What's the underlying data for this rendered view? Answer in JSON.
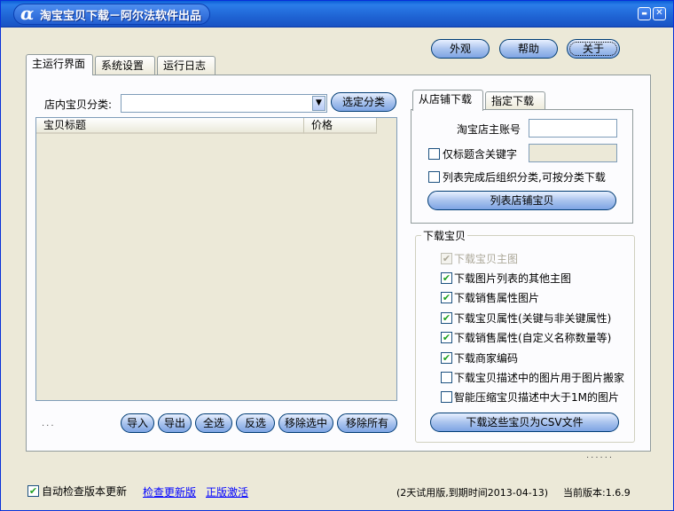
{
  "window": {
    "title": "淘宝宝贝下载－阿尔法软件出品",
    "logo_glyph": "α",
    "minimize_glyph": "▬",
    "close_glyph": "✕"
  },
  "top_buttons": {
    "appearance": "外观",
    "help": "帮助",
    "about": "关于"
  },
  "main_tabs": [
    {
      "label": "主运行界面",
      "active": true
    },
    {
      "label": "系统设置",
      "active": false
    },
    {
      "label": "运行日志",
      "active": false
    }
  ],
  "category": {
    "label": "店内宝贝分类:",
    "value": "",
    "arrow_glyph": "▼",
    "select_button": "选定分类"
  },
  "product_table": {
    "columns": [
      "宝贝标题",
      "价格"
    ],
    "rows": []
  },
  "list_actions": {
    "dots": "...",
    "import": "导入",
    "export": "导出",
    "select_all": "全选",
    "invert": "反选",
    "remove_selected": "移除选中",
    "remove_all": "移除所有"
  },
  "source_tabs": [
    {
      "label": "从店铺下载",
      "active": true
    },
    {
      "label": "指定下载",
      "active": false
    }
  ],
  "shop": {
    "owner_label": "淘宝店主账号",
    "owner_value": "",
    "keyword_only_label": "仅标题含关键字",
    "keyword_only_checked": false,
    "keyword_value": "",
    "organize_label": "列表完成后组织分类,可按分类下载",
    "organize_checked": false,
    "list_button": "列表店铺宝贝"
  },
  "download_group": {
    "title": "下载宝贝",
    "check_glyph": "✔",
    "options": [
      {
        "label": "下载宝贝主图",
        "checked": true,
        "disabled": true
      },
      {
        "label": "下载图片列表的其他主图",
        "checked": true,
        "disabled": false
      },
      {
        "label": "下载销售属性图片",
        "checked": true,
        "disabled": false
      },
      {
        "label": "下载宝贝属性(关键与非关键属性)",
        "checked": true,
        "disabled": false
      },
      {
        "label": "下载销售属性(自定义名称数量等)",
        "checked": true,
        "disabled": false
      },
      {
        "label": "下载商家编码",
        "checked": true,
        "disabled": false
      },
      {
        "label": "下载宝贝描述中的图片用于图片搬家",
        "checked": false,
        "disabled": false
      },
      {
        "label": "智能压缩宝贝描述中大于1M的图片",
        "checked": false,
        "disabled": false
      }
    ],
    "csv_button": "下载这些宝贝为CSV文件"
  },
  "footer": {
    "dots": "......",
    "auto_update_label": "自动检查版本更新",
    "auto_update_checked": true,
    "check_update_link": "检查更新版",
    "activate_link": "正版激活",
    "trial_text": "(2天试用版,到期时间2013-04-13)",
    "version_text": "当前版本:1.6.9"
  }
}
